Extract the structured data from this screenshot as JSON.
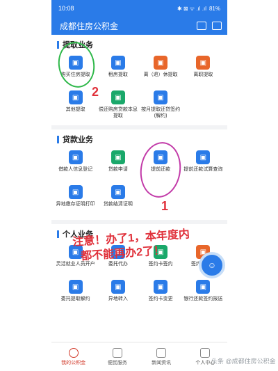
{
  "status": {
    "time": "10:08",
    "battery": "81%",
    "signal": "✱ ⊠ ᯤ .ıl .ıl"
  },
  "header": {
    "title": "成都住房公积金"
  },
  "sections": [
    {
      "title": "提取业务",
      "items": [
        {
          "label": "购买住房提取",
          "color": "blue",
          "icon": "house-upload-icon"
        },
        {
          "label": "租房提取",
          "color": "blue",
          "icon": "house-icon"
        },
        {
          "label": "离（退）休提取",
          "color": "orange",
          "icon": "person-retire-icon"
        },
        {
          "label": "离职提取",
          "color": "orange",
          "icon": "person-leave-icon"
        },
        {
          "label": "其他提取",
          "color": "blue",
          "icon": "family-icon"
        },
        {
          "label": "偿还购房贷款本息提取",
          "color": "green",
          "icon": "coins-icon"
        },
        {
          "label": "按月提取还贷签约(解约)",
          "color": "blue",
          "icon": "calendar-icon"
        }
      ]
    },
    {
      "title": "贷款业务",
      "items": [
        {
          "label": "借款人信息登记",
          "color": "blue",
          "icon": "id-card-icon"
        },
        {
          "label": "贷款申请",
          "color": "green",
          "icon": "loan-apply-icon"
        },
        {
          "label": "提前还款",
          "color": "blue",
          "icon": "repay-upload-icon"
        },
        {
          "label": "提前还款试算查询",
          "color": "blue",
          "icon": "calculator-icon"
        },
        {
          "label": "异地缴存证明打印",
          "color": "blue",
          "icon": "print-icon"
        },
        {
          "label": "贷款结清证明",
          "color": "blue",
          "icon": "certificate-icon"
        }
      ]
    },
    {
      "title": "个人业务",
      "items": [
        {
          "label": "灵活就业人员开户",
          "color": "blue",
          "icon": "person-card-icon"
        },
        {
          "label": "委托代办",
          "color": "blue",
          "icon": "delegate-icon"
        },
        {
          "label": "签约卡签约",
          "color": "green",
          "icon": "card-sign-icon"
        },
        {
          "label": "签约卡解约",
          "color": "orange",
          "icon": "card-unsign-icon"
        },
        {
          "label": "委托提取解约",
          "color": "blue",
          "icon": "delegate-cancel-icon"
        },
        {
          "label": "异地转入",
          "color": "blue",
          "icon": "transfer-in-icon"
        },
        {
          "label": "签约卡变更",
          "color": "blue",
          "icon": "card-change-icon"
        },
        {
          "label": "银行还款签约报送",
          "color": "blue",
          "icon": "bank-icon"
        }
      ]
    }
  ],
  "annotations": {
    "note_line1": "注意！办了1，本年度内",
    "note_line2": "都不能再办2了！",
    "num1": "1",
    "num2": "2"
  },
  "tabs": [
    {
      "label": "我的公积金",
      "active": true
    },
    {
      "label": "便民服务",
      "active": false
    },
    {
      "label": "新闻资讯",
      "active": false
    },
    {
      "label": "个人中心",
      "active": false
    }
  ],
  "watermark": "头条 @成都住房公积金"
}
